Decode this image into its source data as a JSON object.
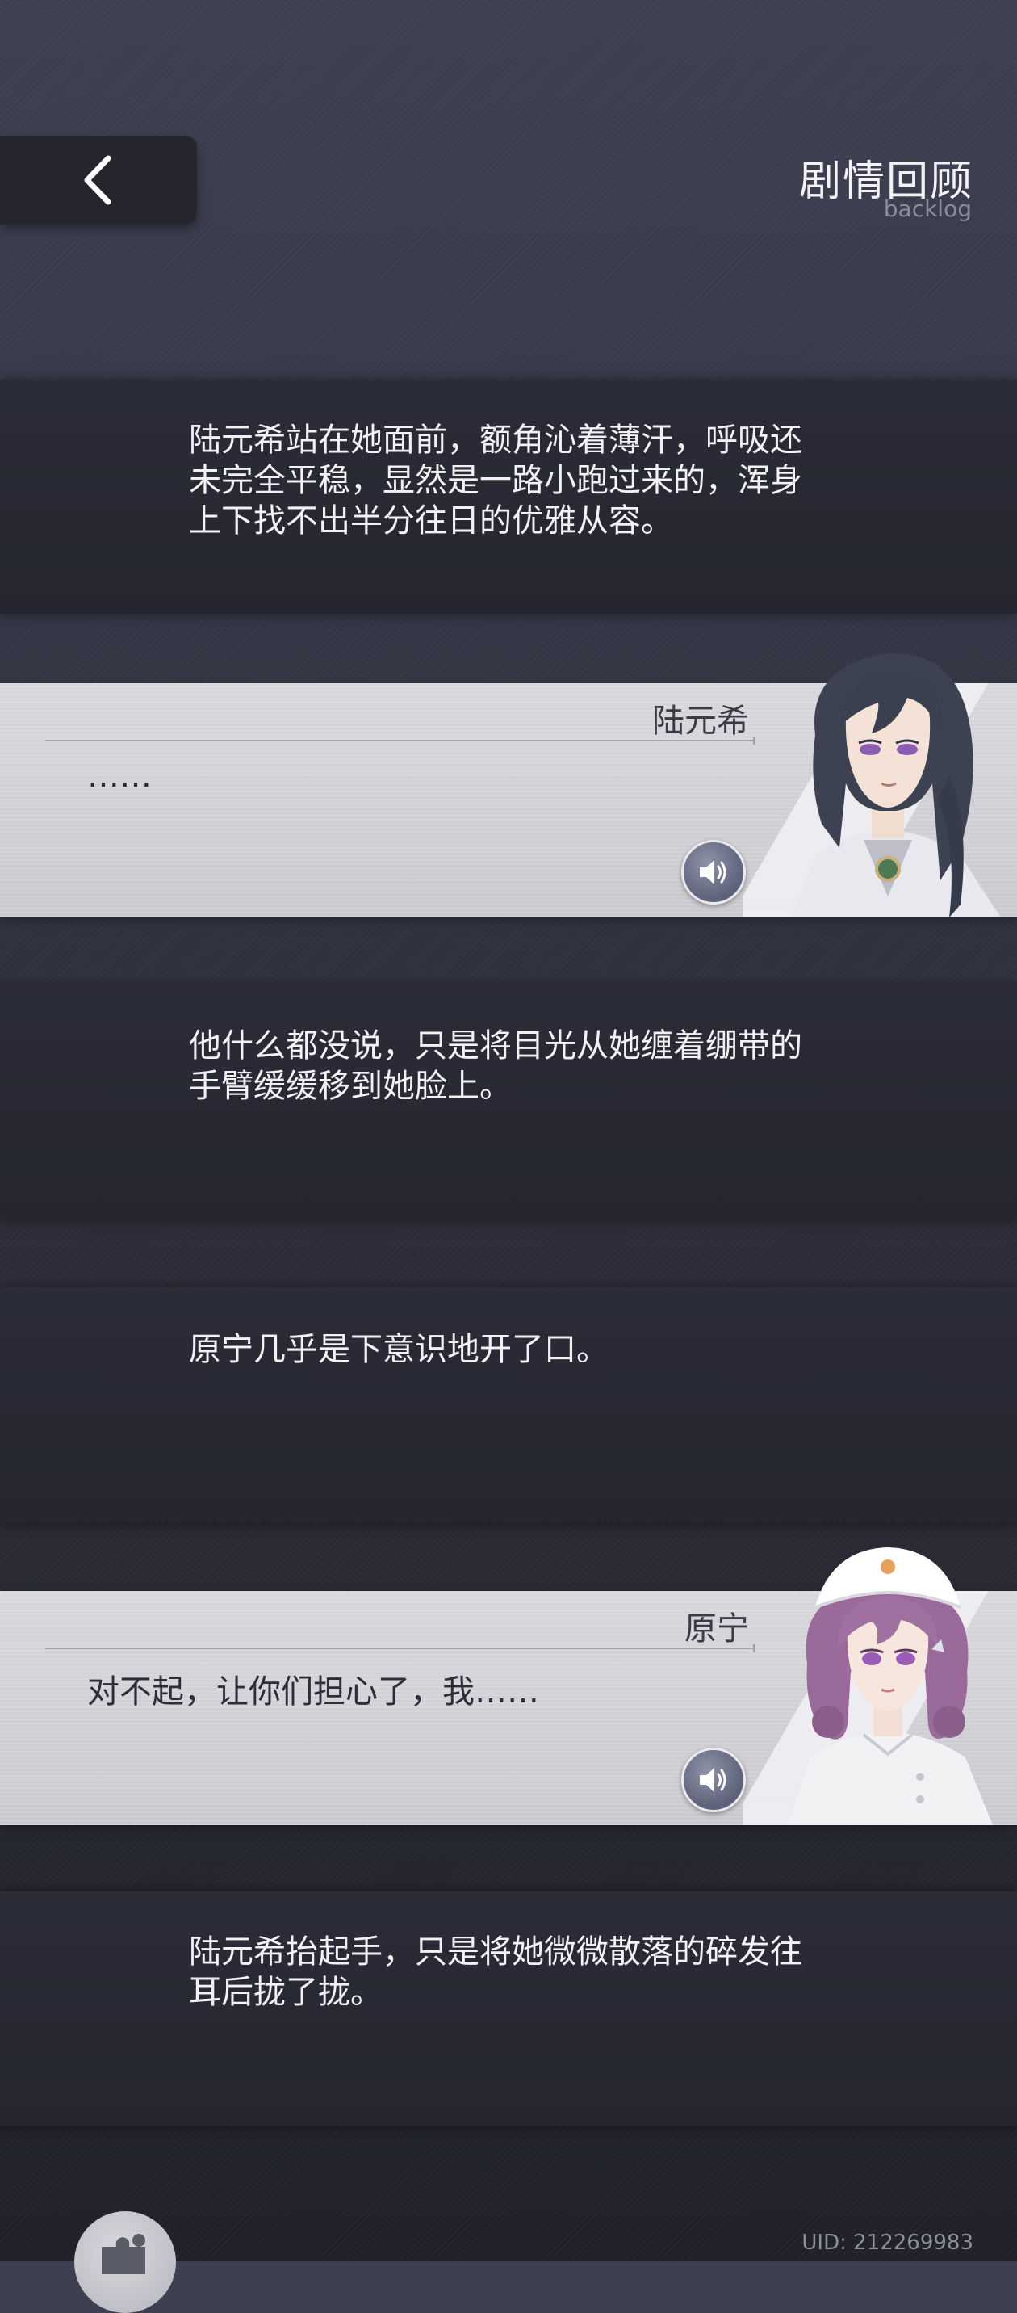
{
  "header": {
    "title": "剧情回顾",
    "subtitle": "backlog"
  },
  "entries": [
    {
      "type": "narration",
      "text": "陆元希站在她面前，额角沁着薄汗，呼吸还未完全平稳，显然是一路小跑过来的，浑身上下找不出半分往日的优雅从容。"
    },
    {
      "type": "dialogue",
      "speaker": "陆元希",
      "text": "……",
      "voice_icon": "speaker-icon",
      "portrait": "dark-haired-man-portrait"
    },
    {
      "type": "narration",
      "text": "他什么都没说，只是将目光从她缠着绷带的手臂缓缓移到她脸上。"
    },
    {
      "type": "narration",
      "text": "原宁几乎是下意识地开了口。"
    },
    {
      "type": "dialogue",
      "speaker": "原宁",
      "text": "对不起，让你们担心了，我……",
      "voice_icon": "speaker-icon",
      "portrait": "nurse-girl-portrait"
    },
    {
      "type": "narration",
      "text": "陆元希抬起手，只是将她微微散落的碎发往耳后拢了拢。"
    }
  ],
  "footer": {
    "uid": "UID: 212269983"
  },
  "colors": {
    "panel_dark": "#25262f",
    "panel_light": "#d2d2d7",
    "accent_voice": "#5d6179"
  }
}
